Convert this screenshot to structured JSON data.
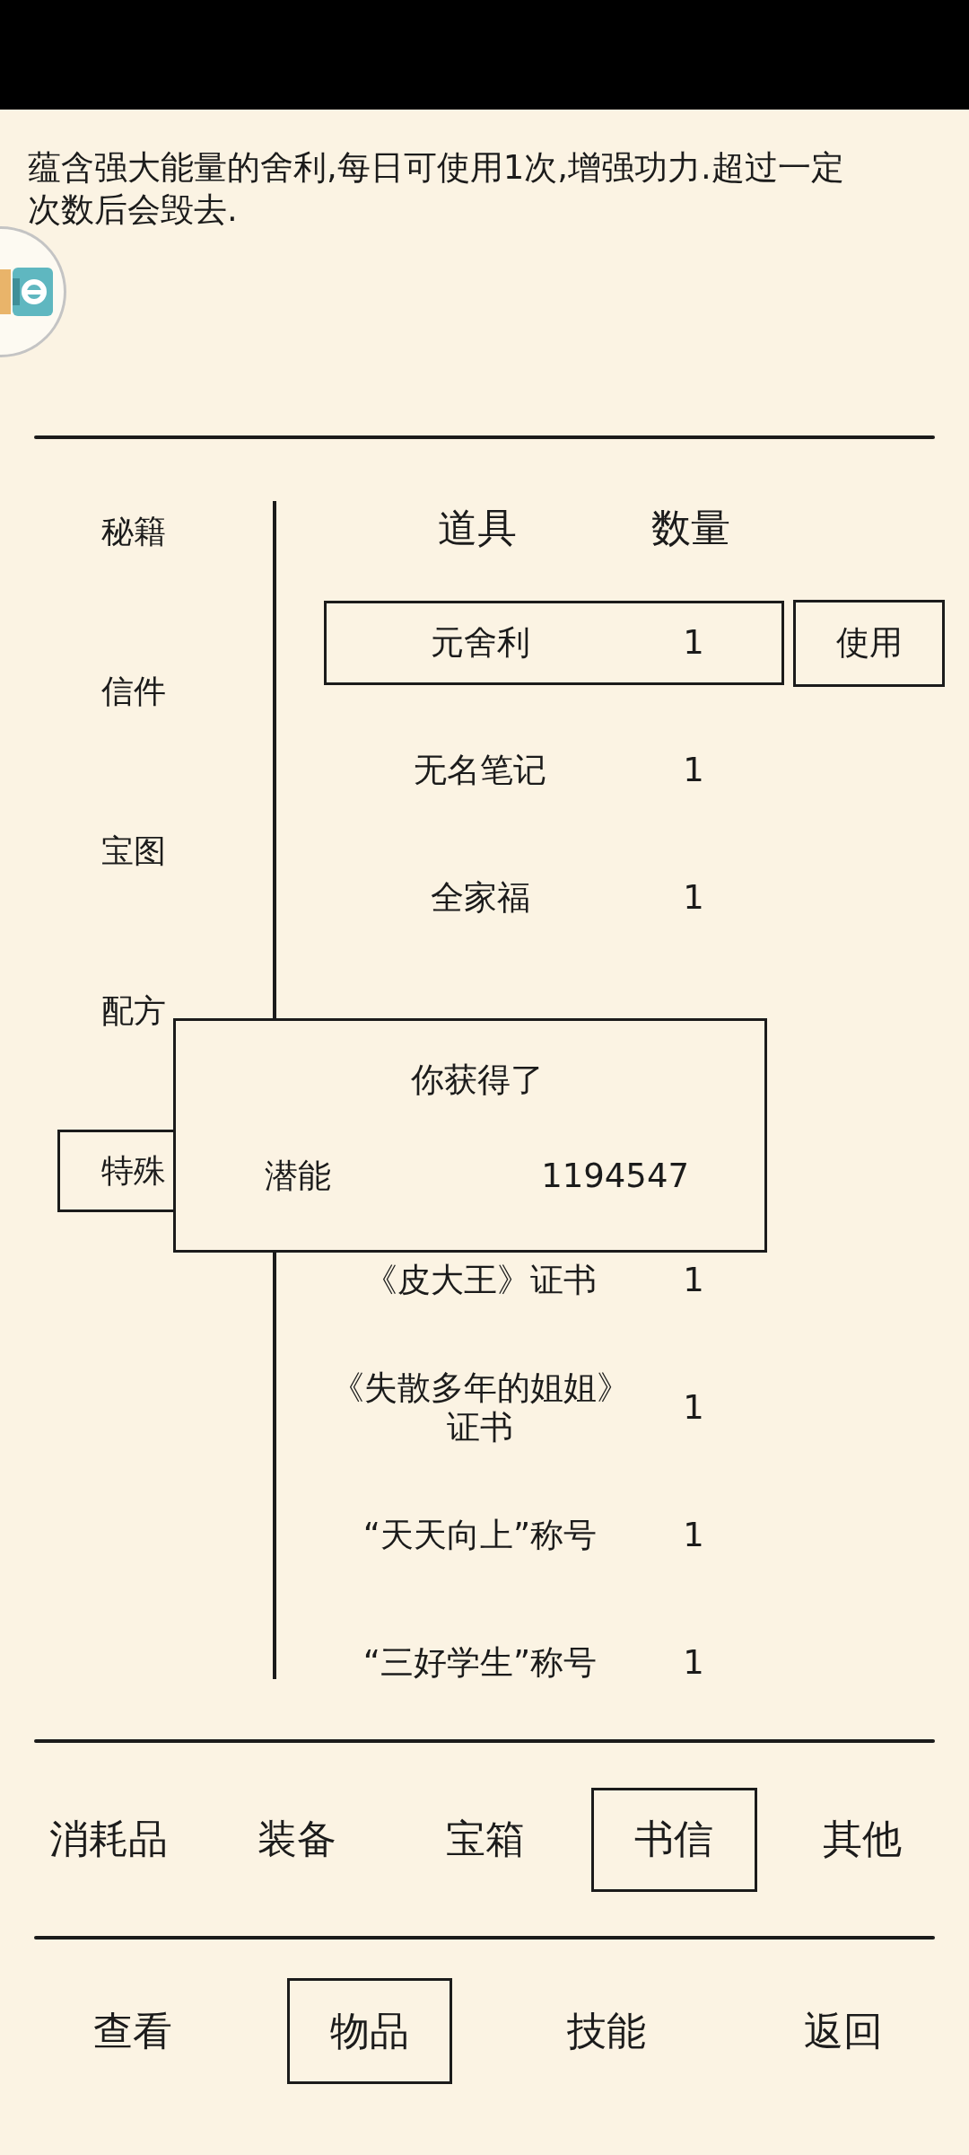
{
  "description": "蕴含强大能量的舍利,每日可使用1次,增强功力.超过一定次数后会毁去.",
  "sidebar": {
    "items": [
      {
        "label": "秘籍",
        "selected": false
      },
      {
        "label": "信件",
        "selected": false
      },
      {
        "label": "宝图",
        "selected": false
      },
      {
        "label": "配方",
        "selected": false
      },
      {
        "label": "特殊",
        "selected": true
      }
    ]
  },
  "table": {
    "columns": [
      "道具",
      "数量"
    ],
    "rows": [
      {
        "name": "元舍利",
        "quantity": "1",
        "selected": true
      },
      {
        "name": "无名笔记",
        "quantity": "1",
        "selected": false
      },
      {
        "name": "全家福",
        "quantity": "1",
        "selected": false
      },
      {
        "name": "《皮大王》证书",
        "quantity": "1",
        "selected": false
      },
      {
        "name": "《失散多年的姐姐》证书",
        "quantity": "1",
        "selected": false
      },
      {
        "name": "“天天向上”称号",
        "quantity": "1",
        "selected": false
      },
      {
        "name": "“三好学生”称号",
        "quantity": "1",
        "selected": false
      }
    ],
    "use_button": "使用"
  },
  "dialog": {
    "title": "你获得了",
    "rewards": [
      {
        "name": "潜能",
        "amount": "1194547"
      }
    ]
  },
  "category_tabs": [
    {
      "label": "消耗品",
      "selected": false
    },
    {
      "label": "装备",
      "selected": false
    },
    {
      "label": "宝箱",
      "selected": false
    },
    {
      "label": "书信",
      "selected": true
    },
    {
      "label": "其他",
      "selected": false
    }
  ],
  "nav_tabs": [
    {
      "label": "查看",
      "selected": false
    },
    {
      "label": "物品",
      "selected": true
    },
    {
      "label": "技能",
      "selected": false
    },
    {
      "label": "返回",
      "selected": false
    }
  ]
}
